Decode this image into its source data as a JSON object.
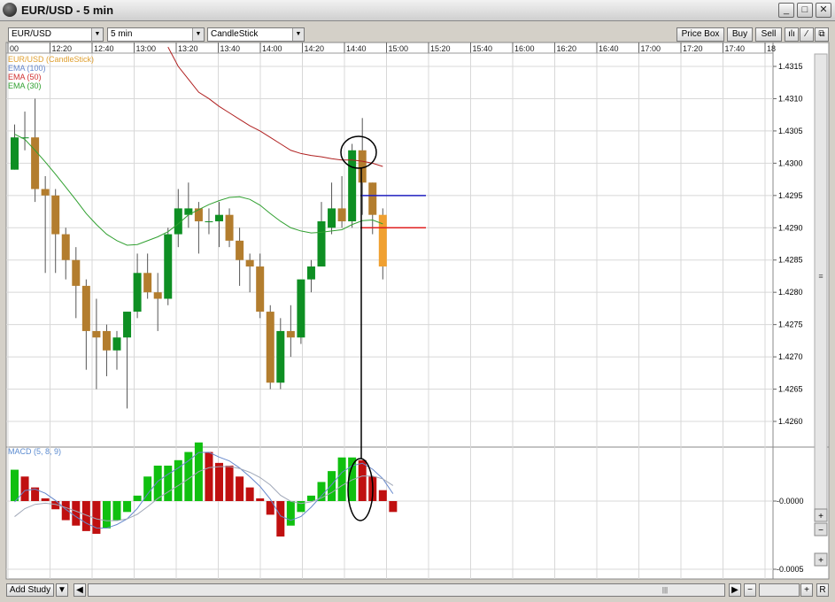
{
  "window": {
    "title": "EUR/USD - 5 min",
    "min_glyph": "_",
    "max_glyph": "□",
    "close_glyph": "✕"
  },
  "toolbar": {
    "symbol": "EUR/USD",
    "interval": "5 min",
    "chart_style": "CandleStick",
    "price_box": "Price Box",
    "buy": "Buy",
    "sell": "Sell"
  },
  "legend": [
    {
      "label": "EUR/USD (CandleStick)",
      "color": "#e0a030"
    },
    {
      "label": "EMA (100)",
      "color": "#6688cc"
    },
    {
      "label": "EMA (50)",
      "color": "#d03030"
    },
    {
      "label": "EMA (30)",
      "color": "#30a030"
    }
  ],
  "macd_label": "MACD (5, 8, 9)",
  "time_axis": [
    "00",
    "12:20",
    "12:40",
    "13:00",
    "13:20",
    "13:40",
    "14:00",
    "14:20",
    "14:40",
    "15:00",
    "15:20",
    "15:40",
    "16:00",
    "16:20",
    "16:40",
    "17:00",
    "17:20",
    "17:40",
    "18"
  ],
  "price_axis": [
    "1.4315",
    "1.4310",
    "1.4305",
    "1.4300",
    "1.4295",
    "1.4290",
    "1.4285",
    "1.4280",
    "1.4275",
    "1.4270",
    "1.4265",
    "1.4260"
  ],
  "macd_axis": [
    "-0.0000",
    "-0.0005"
  ],
  "statusbar": {
    "add_study": "Add Study",
    "scroll_glyph": "|||"
  },
  "colors": {
    "bull": "#0e8f23",
    "bear": "#b37d2e",
    "current": "#f0a030",
    "ema100": "#6688cc",
    "ema50": "#b02020",
    "ema30": "#30a030",
    "macd_up": "#10c010",
    "macd_down": "#c01010",
    "grid": "#d8d8d8",
    "blue_line": "#2020c0",
    "red_line": "#e02020"
  },
  "chart_data": {
    "type": "candlestick",
    "candles": [
      {
        "o": 1.4299,
        "h": 1.4306,
        "l": 1.4299,
        "c": 1.4304
      },
      {
        "o": 1.4304,
        "h": 1.4308,
        "l": 1.4302,
        "c": 1.4304
      },
      {
        "o": 1.4304,
        "h": 1.431,
        "l": 1.4294,
        "c": 1.4296
      },
      {
        "o": 1.4296,
        "h": 1.4298,
        "l": 1.4283,
        "c": 1.4295
      },
      {
        "o": 1.4295,
        "h": 1.4296,
        "l": 1.4283,
        "c": 1.4289
      },
      {
        "o": 1.4289,
        "h": 1.429,
        "l": 1.4282,
        "c": 1.4285
      },
      {
        "o": 1.4285,
        "h": 1.4287,
        "l": 1.4276,
        "c": 1.4281
      },
      {
        "o": 1.4281,
        "h": 1.4282,
        "l": 1.4268,
        "c": 1.4274
      },
      {
        "o": 1.4274,
        "h": 1.4279,
        "l": 1.4265,
        "c": 1.4273
      },
      {
        "o": 1.4274,
        "h": 1.4275,
        "l": 1.4267,
        "c": 1.4271
      },
      {
        "o": 1.4271,
        "h": 1.4274,
        "l": 1.4268,
        "c": 1.4273
      },
      {
        "o": 1.4273,
        "h": 1.4277,
        "l": 1.4262,
        "c": 1.4277
      },
      {
        "o": 1.4277,
        "h": 1.4286,
        "l": 1.4276,
        "c": 1.4283
      },
      {
        "o": 1.4283,
        "h": 1.4286,
        "l": 1.4279,
        "c": 1.428
      },
      {
        "o": 1.428,
        "h": 1.4283,
        "l": 1.4274,
        "c": 1.4279
      },
      {
        "o": 1.4279,
        "h": 1.429,
        "l": 1.4278,
        "c": 1.4289
      },
      {
        "o": 1.4289,
        "h": 1.4296,
        "l": 1.4287,
        "c": 1.4293
      },
      {
        "o": 1.4292,
        "h": 1.4297,
        "l": 1.429,
        "c": 1.4293
      },
      {
        "o": 1.4293,
        "h": 1.4294,
        "l": 1.4286,
        "c": 1.4291
      },
      {
        "o": 1.4291,
        "h": 1.4293,
        "l": 1.4289,
        "c": 1.4291
      },
      {
        "o": 1.4291,
        "h": 1.4294,
        "l": 1.4287,
        "c": 1.4292
      },
      {
        "o": 1.4292,
        "h": 1.4293,
        "l": 1.4287,
        "c": 1.4288
      },
      {
        "o": 1.4288,
        "h": 1.429,
        "l": 1.4281,
        "c": 1.4285
      },
      {
        "o": 1.4285,
        "h": 1.4286,
        "l": 1.428,
        "c": 1.4284
      },
      {
        "o": 1.4284,
        "h": 1.4286,
        "l": 1.4276,
        "c": 1.4277
      },
      {
        "o": 1.4277,
        "h": 1.4278,
        "l": 1.4265,
        "c": 1.4266
      },
      {
        "o": 1.4266,
        "h": 1.4276,
        "l": 1.4265,
        "c": 1.4274
      },
      {
        "o": 1.4274,
        "h": 1.4278,
        "l": 1.427,
        "c": 1.4273
      },
      {
        "o": 1.4273,
        "h": 1.4282,
        "l": 1.4272,
        "c": 1.4282
      },
      {
        "o": 1.4282,
        "h": 1.4285,
        "l": 1.428,
        "c": 1.4284
      },
      {
        "o": 1.4284,
        "h": 1.4294,
        "l": 1.4284,
        "c": 1.4291
      },
      {
        "o": 1.429,
        "h": 1.4297,
        "l": 1.4289,
        "c": 1.4293
      },
      {
        "o": 1.4293,
        "h": 1.4298,
        "l": 1.429,
        "c": 1.4291
      },
      {
        "o": 1.4291,
        "h": 1.4303,
        "l": 1.429,
        "c": 1.4302
      },
      {
        "o": 1.4302,
        "h": 1.4307,
        "l": 1.4292,
        "c": 1.4297
      },
      {
        "o": 1.4297,
        "h": 1.4297,
        "l": 1.4289,
        "c": 1.4292
      },
      {
        "o": 1.4292,
        "h": 1.4293,
        "l": 1.4282,
        "c": 1.4284
      }
    ],
    "ema30": [
      1.43045,
      1.43037,
      1.4302,
      1.43002,
      1.42983,
      1.42963,
      1.42943,
      1.42922,
      1.42905,
      1.4289,
      1.4288,
      1.42873,
      1.42874,
      1.4288,
      1.42886,
      1.42894,
      1.42906,
      1.4292,
      1.42928,
      1.42936,
      1.42942,
      1.42947,
      1.42948,
      1.42944,
      1.42935,
      1.42922,
      1.4291,
      1.429,
      1.42895,
      1.42892,
      1.42893,
      1.42895,
      1.42897,
      1.42905,
      1.42911,
      1.42912,
      1.42906
    ],
    "ema50": [
      null,
      null,
      null,
      null,
      null,
      null,
      null,
      null,
      null,
      null,
      null,
      null,
      null,
      null,
      null,
      1.4318,
      1.4315,
      1.4313,
      1.4311,
      1.431,
      1.43088,
      1.43078,
      1.43068,
      1.43058,
      1.4305,
      1.4304,
      1.4303,
      1.4302,
      1.43015,
      1.43012,
      1.4301,
      1.43007,
      1.43005,
      1.43005,
      1.43003,
      1.43,
      1.42995
    ],
    "macd_hist": [
      0.00023,
      0.00018,
      0.0001,
      2e-05,
      -6e-05,
      -0.00014,
      -0.00018,
      -0.00022,
      -0.00024,
      -0.0002,
      -0.00014,
      -8e-05,
      4e-05,
      0.00018,
      0.00026,
      0.00026,
      0.0003,
      0.00036,
      0.00043,
      0.00036,
      0.00028,
      0.00026,
      0.00018,
      0.0001,
      2e-05,
      -0.0001,
      -0.00026,
      -0.00018,
      -8e-05,
      4e-05,
      0.00014,
      0.00022,
      0.00032,
      0.00032,
      0.0003,
      0.00018,
      8e-05,
      -8e-05
    ]
  }
}
